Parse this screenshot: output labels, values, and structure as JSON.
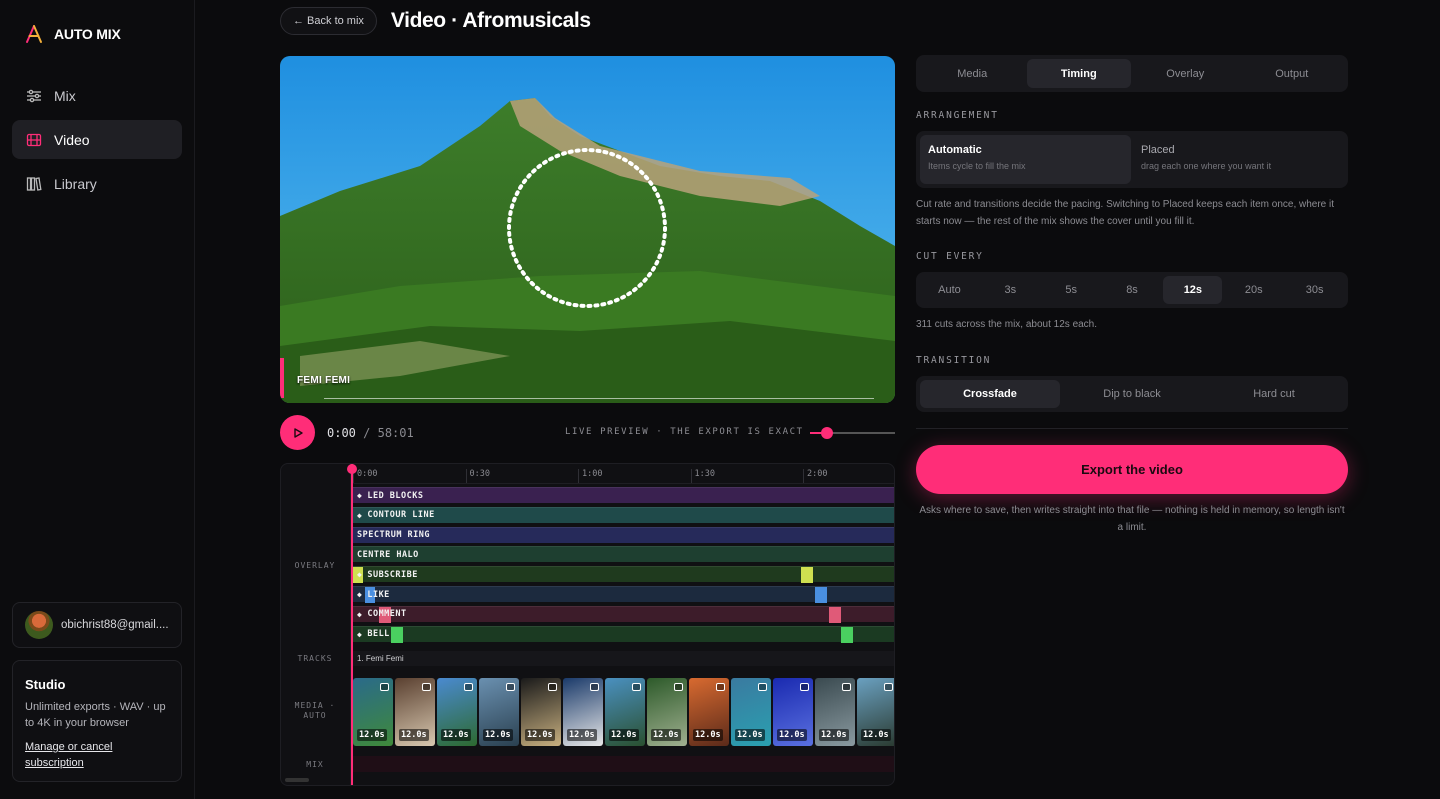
{
  "app": {
    "name": "AUTO MIX",
    "accent": "#ff2d78"
  },
  "sidebar": {
    "items": [
      {
        "label": "Mix",
        "icon": "sliders-icon"
      },
      {
        "label": "Video",
        "icon": "film-icon"
      },
      {
        "label": "Library",
        "icon": "library-icon"
      }
    ],
    "user_email": "obichrist88@gmail....",
    "plan": {
      "title": "Studio",
      "desc": "Unlimited exports · WAV · up to 4K in your browser",
      "link": "Manage or cancel subscription"
    }
  },
  "header": {
    "back_label": "← Back to mix",
    "title": "Video · Afromusicals"
  },
  "player": {
    "track_name": "FEMI FEMI",
    "time_current": "0:00",
    "time_sep": " / ",
    "time_total": "58:01",
    "live_note": "LIVE PREVIEW · THE EXPORT IS EXACT",
    "volume": 0.2
  },
  "timeline": {
    "ticks": [
      "0:00",
      "0:30",
      "1:00",
      "1:30",
      "2:00"
    ],
    "labels": {
      "overlay": "OVERLAY",
      "tracks": "TRACKS",
      "media": "MEDIA · AUTO",
      "mix": "MIX"
    },
    "overlay_lanes": [
      {
        "label": "LED BLOCKS",
        "diamond": "◆",
        "color": "#3a2150"
      },
      {
        "label": "CONTOUR LINE",
        "diamond": "◆",
        "color": "#1f4a4a"
      },
      {
        "label": "SPECTRUM RING",
        "diamond": "",
        "color": "#262a5a"
      },
      {
        "label": "CENTRE HALO",
        "diamond": "",
        "color": "#1e3f30"
      },
      {
        "label": "SUBSCRIBE",
        "diamond": "◆",
        "color": "#1f3a1e"
      },
      {
        "label": "LIKE",
        "diamond": "◆",
        "color": "#1c2a3e"
      },
      {
        "label": "COMMENT",
        "diamond": "◆",
        "color": "#3d1c2a"
      },
      {
        "label": "BELL",
        "diamond": "◆",
        "color": "#1b3a22"
      }
    ],
    "track_name": "1. Femi Femi",
    "media_clips": [
      "12.0s",
      "12.0s",
      "12.0s",
      "12.0s",
      "12.0s",
      "12.0s",
      "12.0s",
      "12.0s",
      "12.0s",
      "12.0s",
      "12.0s",
      "12.0s",
      "12.0s"
    ]
  },
  "panel": {
    "tabs": [
      "Media",
      "Timing",
      "Overlay",
      "Output"
    ],
    "active_tab": "Timing",
    "arrangement": {
      "heading": "ARRANGEMENT",
      "options": [
        {
          "title": "Automatic",
          "sub": "Items cycle to fill the mix"
        },
        {
          "title": "Placed",
          "sub": "drag each one where you want it"
        }
      ],
      "help": "Cut rate and transitions decide the pacing. Switching to Placed keeps each item once, where it starts now — the rest of the mix shows the cover until you fill it."
    },
    "cut_every": {
      "heading": "CUT EVERY",
      "options": [
        "Auto",
        "3s",
        "5s",
        "8s",
        "12s",
        "20s",
        "30s"
      ],
      "selected": "12s",
      "help": "311 cuts across the mix, about 12s each."
    },
    "transition": {
      "heading": "TRANSITION",
      "options": [
        "Crossfade",
        "Dip to black",
        "Hard cut"
      ],
      "selected": "Crossfade"
    },
    "export_label": "Export the video",
    "export_note": "Asks where to save, then writes straight into that file — nothing is held in memory, so length isn't a limit."
  }
}
